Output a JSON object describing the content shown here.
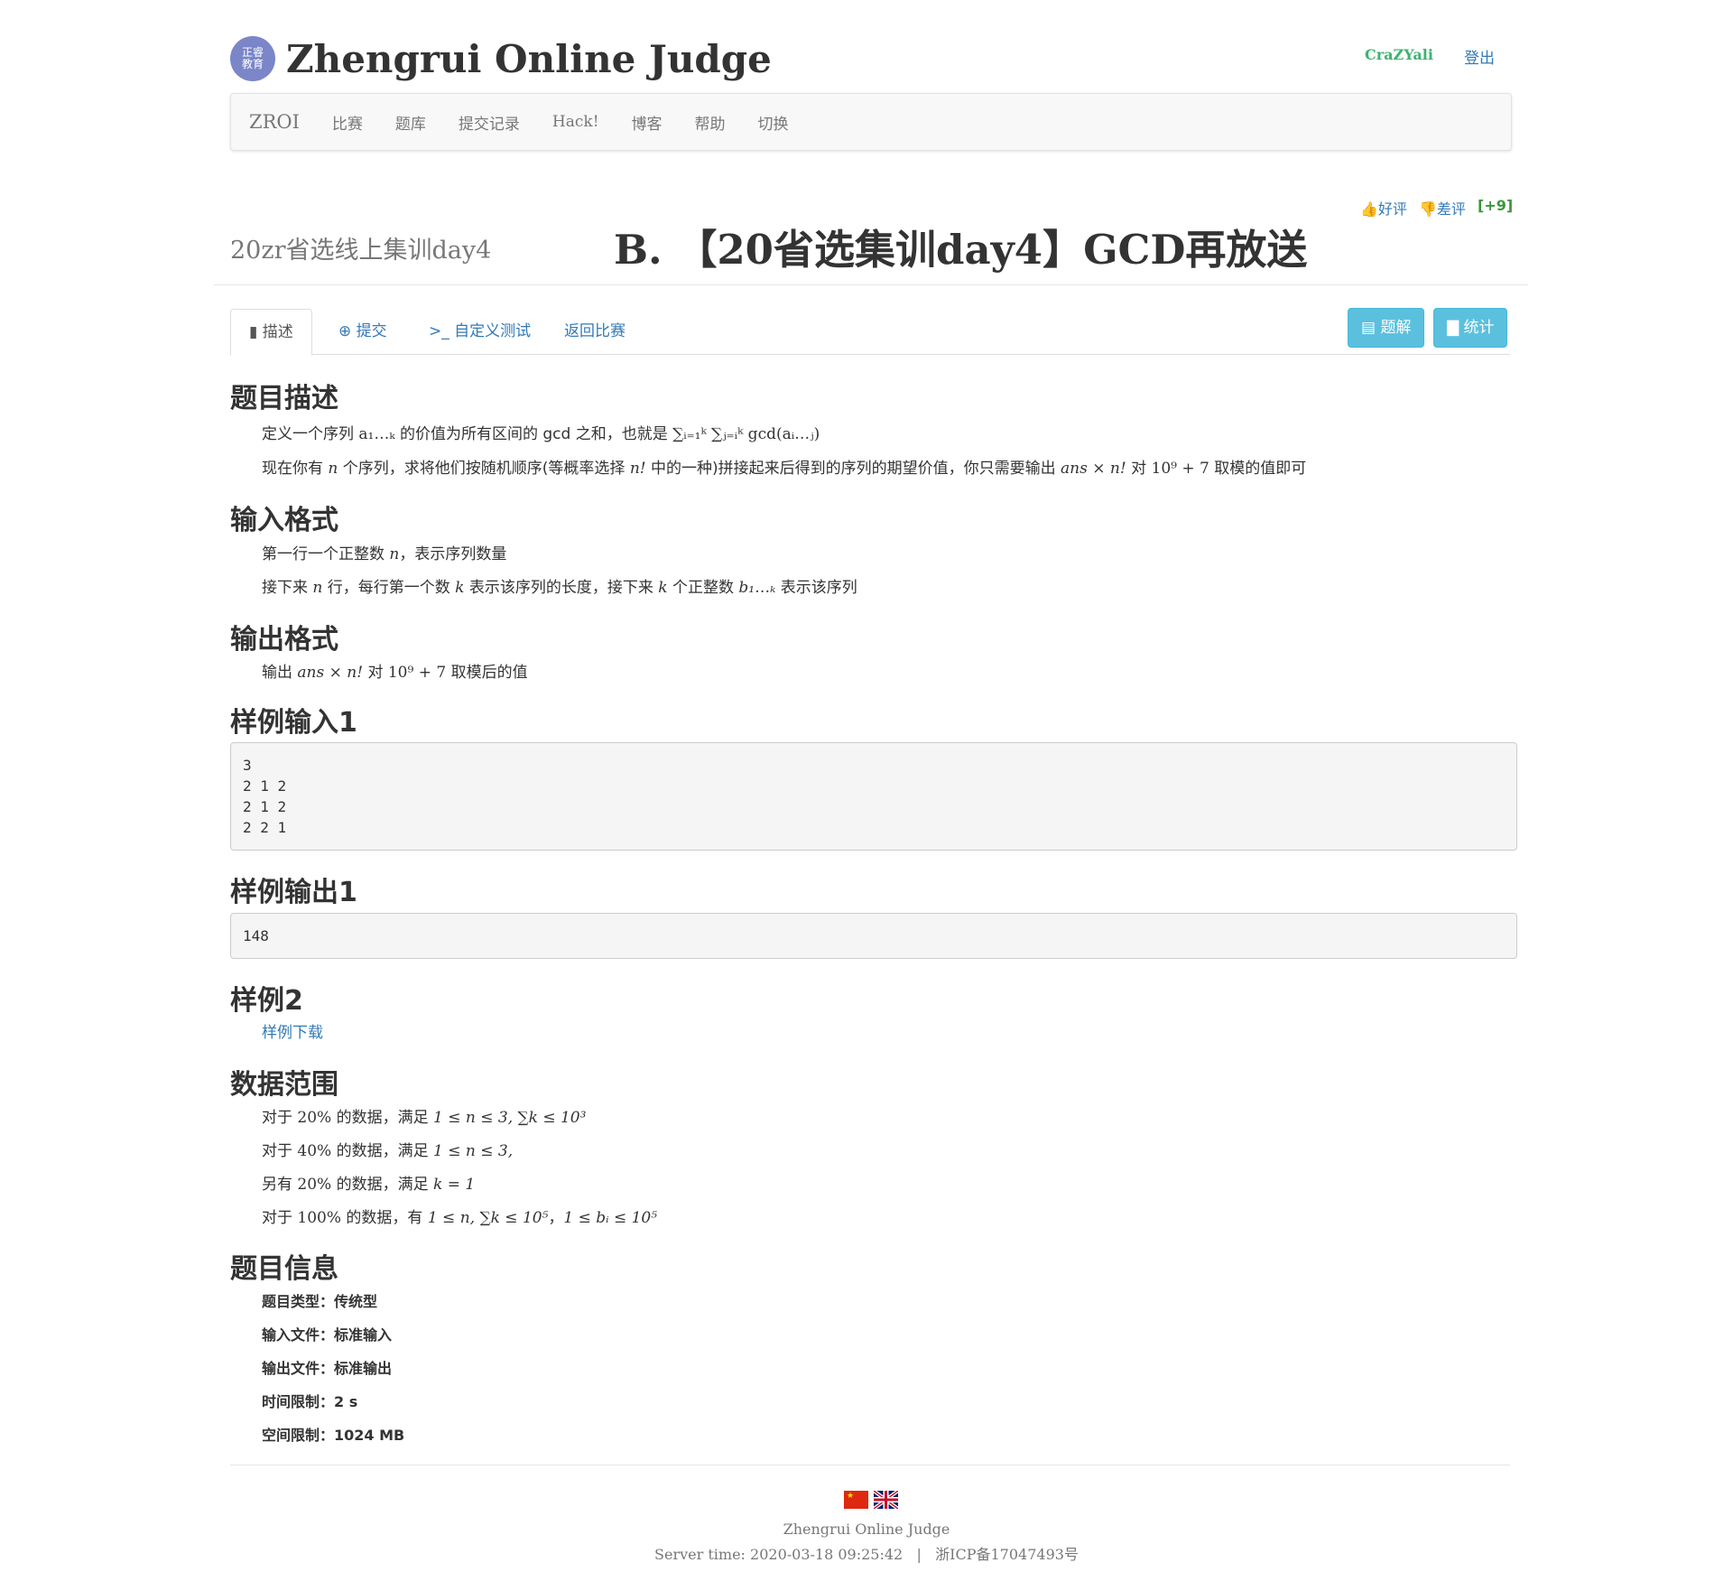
{
  "header": {
    "site_title": "Zhengrui Online Judge",
    "logo_text": "正睿教育",
    "username": "CraZYali",
    "logout": "登出"
  },
  "nav": [
    "ZROI",
    "比赛",
    "题库",
    "提交记录",
    "Hack!",
    "博客",
    "帮助",
    "切换"
  ],
  "vote": {
    "up": "好评",
    "down": "差评",
    "count": "[+9]"
  },
  "contest_name": "20zr省选线上集训day4",
  "problem_title": "B. 【20省选集训day4】GCD再放送",
  "tabs": {
    "describe": "描述",
    "submit": "提交",
    "custom_test": "自定义测试",
    "back": "返回比赛"
  },
  "buttons": {
    "solution": "题解",
    "stats": "统计"
  },
  "sections": {
    "desc_title": "题目描述",
    "desc_line1_a": "定义一个序列 ",
    "desc_line1_b": " 的价值为所有区间的 gcd 之和，也就是 ",
    "desc_line2_a": "现在你有 ",
    "desc_line2_b": " 个序列，求将他们按随机顺序(等概率选择 ",
    "desc_line2_c": " 中的一种)拼接起来后得到的序列的期望价值，你只需要输出 ",
    "desc_line2_d": " 对 ",
    "desc_line2_e": " 取模的值即可",
    "input_title": "输入格式",
    "input_line1_a": "第一行一个正整数 ",
    "input_line1_b": "，表示序列数量",
    "input_line2_a": "接下来 ",
    "input_line2_b": " 行，每行第一个数 ",
    "input_line2_c": " 表示该序列的长度，接下来 ",
    "input_line2_d": " 个正整数 ",
    "input_line2_e": " 表示该序列",
    "output_title": "输出格式",
    "output_line_a": "输出 ",
    "output_line_b": " 对 ",
    "output_line_c": " 取模后的值",
    "sample_in_title": "样例输入1",
    "sample_in": "3\n2 1 2\n2 1 2\n2 2 1",
    "sample_out_title": "样例输出1",
    "sample_out": "148",
    "sample2_title": "样例2",
    "sample2_link": "样例下载",
    "range_title": "数据范围",
    "range1_a": "对于 ",
    "range1_b": " 的数据，满足 ",
    "range2_a": "对于 ",
    "range2_b": " 的数据，满足 ",
    "range3_a": "另有 ",
    "range3_b": " 的数据，满足 ",
    "range4_a": "对于 ",
    "range4_b": " 的数据，有 ",
    "range4_c": "，",
    "info_title": "题目信息",
    "info_lines": [
      "题目类型：传统型",
      "输入文件：标准输入",
      "输出文件：标准输出",
      "时间限制：2 s",
      "空间限制：1024 MB"
    ]
  },
  "math": {
    "seq": "a₁…ₖ",
    "sum_gcd": "∑ᵢ₌₁ᵏ ∑ⱼ₌ᵢᵏ gcd(aᵢ…ⱼ)",
    "n": "n",
    "nfact": "n!",
    "ans": "ans × n!",
    "mod": "10⁹ + 7",
    "k": "k",
    "b": "b₁…ₖ",
    "p20": "20%",
    "p40": "40%",
    "p100": "100%",
    "c1": "1 ≤ n ≤ 3,  ∑k ≤ 10³",
    "c2": "1 ≤ n ≤ 3,",
    "c3": "k = 1",
    "c4a": "1 ≤ n, ∑k ≤ 10⁵",
    "c4b": "1 ≤ bᵢ ≤ 10⁵"
  },
  "footer": {
    "name": "Zhengrui Online Judge",
    "server_time": "Server time: 2020-03-18 09:25:42",
    "sep": "|",
    "icp": "浙ICP备17047493号"
  }
}
